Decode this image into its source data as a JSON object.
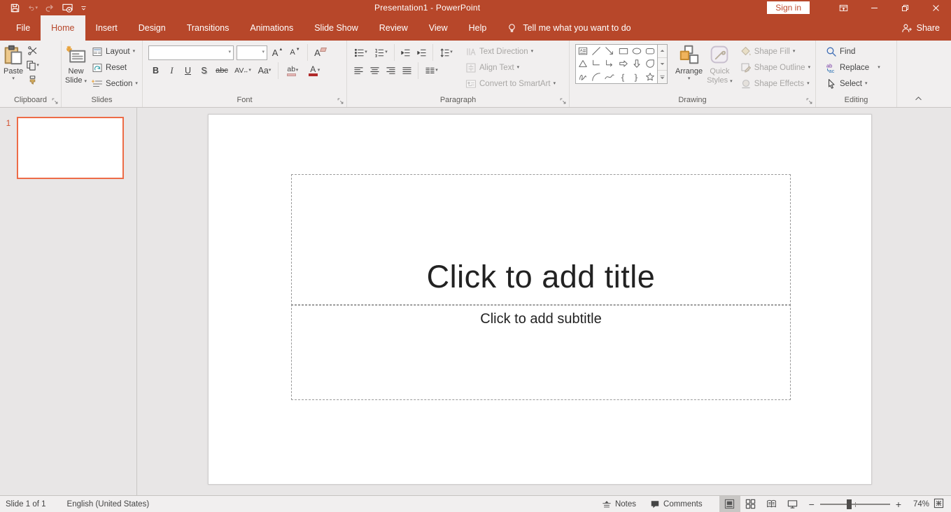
{
  "titlebar": {
    "title": "Presentation1  -  PowerPoint",
    "sign_in": "Sign in"
  },
  "tabs": {
    "items": [
      {
        "label": "File"
      },
      {
        "label": "Home",
        "active": true
      },
      {
        "label": "Insert"
      },
      {
        "label": "Design"
      },
      {
        "label": "Transitions"
      },
      {
        "label": "Animations"
      },
      {
        "label": "Slide Show"
      },
      {
        "label": "Review"
      },
      {
        "label": "View"
      },
      {
        "label": "Help"
      }
    ],
    "tell_me": "Tell me what you want to do",
    "share": "Share"
  },
  "ribbon": {
    "clipboard": {
      "label": "Clipboard",
      "paste": "Paste"
    },
    "slides": {
      "label": "Slides",
      "new_slide_line1": "New",
      "new_slide_line2": "Slide",
      "layout": "Layout",
      "reset": "Reset",
      "section": "Section"
    },
    "font": {
      "label": "Font",
      "font_name_value": "",
      "font_size_value": "",
      "bold": "B",
      "italic": "I",
      "underline": "U",
      "shadow": "S",
      "strikethrough": "abc",
      "char_spacing": "AV",
      "change_case": "Aa",
      "highlight": "ab",
      "font_color": "A",
      "grow": "A",
      "shrink": "A",
      "clear": "A"
    },
    "paragraph": {
      "label": "Paragraph",
      "text_direction": "Text Direction",
      "align_text": "Align Text",
      "smartart": "Convert to SmartArt"
    },
    "drawing": {
      "label": "Drawing",
      "arrange": "Arrange",
      "quick_line1": "Quick",
      "quick_line2": "Styles",
      "shape_fill": "Shape Fill",
      "shape_outline": "Shape Outline",
      "shape_effects": "Shape Effects",
      "shapes": [
        "textbox",
        "line",
        "arrow",
        "rectangle",
        "oval",
        "rounded-rectangle",
        "triangle",
        "elbow-connector",
        "elbow-arrow-connector",
        "right-arrow",
        "down-arrow",
        "teardrop",
        "scribble",
        "arc",
        "curve",
        "left-brace",
        "right-brace",
        "star"
      ]
    },
    "editing": {
      "label": "Editing",
      "find": "Find",
      "replace": "Replace",
      "select": "Select"
    }
  },
  "slide_panel": {
    "slide_number": "1"
  },
  "slide": {
    "title_placeholder": "Click to add title",
    "subtitle_placeholder": "Click to add subtitle"
  },
  "statusbar": {
    "slide_indicator": "Slide 1 of 1",
    "language": "English (United States)",
    "notes": "Notes",
    "comments": "Comments",
    "zoom_level": "74%"
  },
  "colors": {
    "brand-red": "#B7472A",
    "accent-orange": "#ED6C47",
    "arrange-gold": "#EFB35C",
    "find-blue": "#3E6DB5",
    "replace-purple": "#7030A0",
    "replace-blue": "#2E74B5"
  }
}
